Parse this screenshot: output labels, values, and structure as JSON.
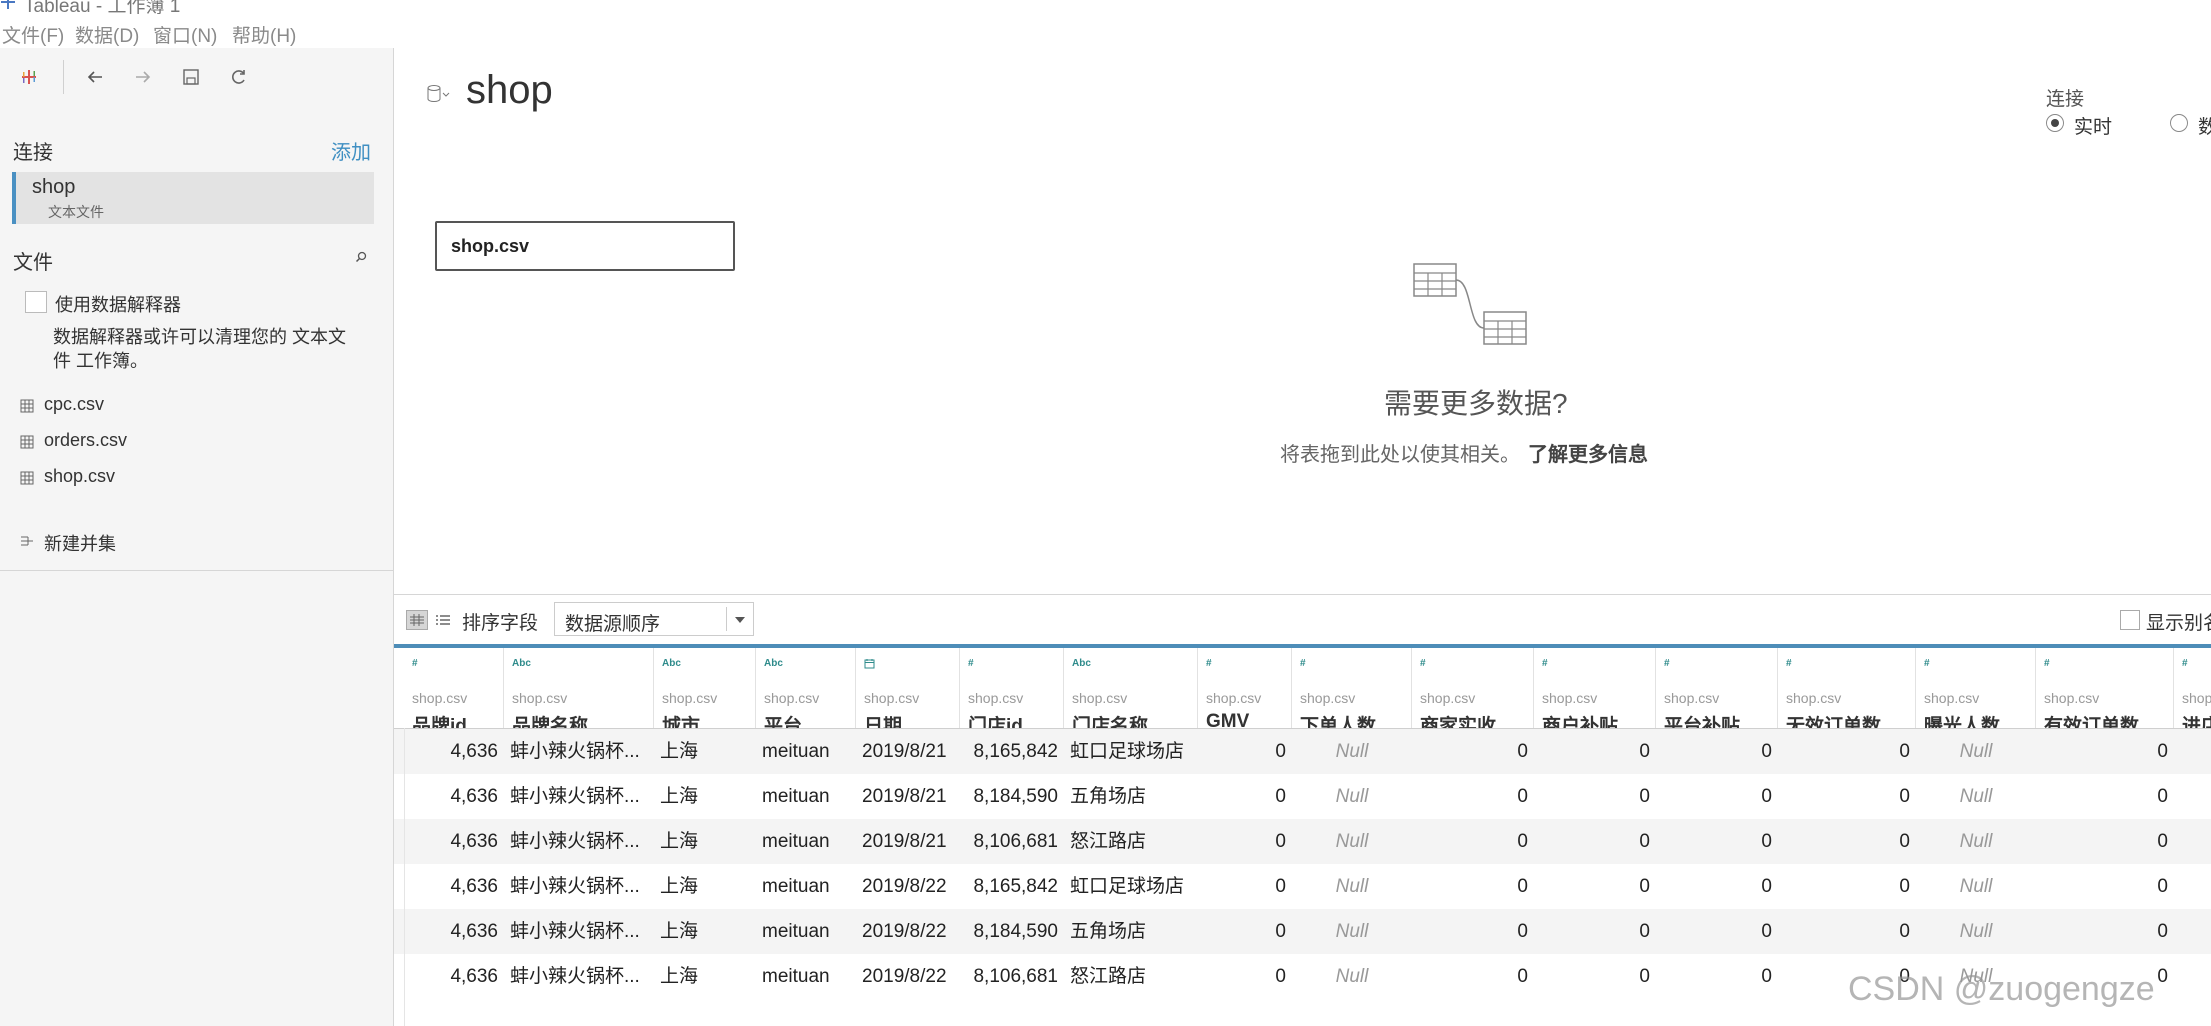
{
  "window": {
    "title": "Tableau - 工作簿 1"
  },
  "menu": [
    "文件(F)",
    "数据(D)",
    "窗口(N)",
    "帮助(H)"
  ],
  "sidebar": {
    "connections_heading": "连接",
    "add_label": "添加",
    "connection": {
      "name": "shop",
      "type": "文本文件"
    },
    "files_heading": "文件",
    "interpreter": {
      "label": "使用数据解释器",
      "description": "数据解释器或许可以清理您的 文本文件 工作簿。",
      "checked": false
    },
    "files": [
      "cpc.csv",
      "orders.csv",
      "shop.csv"
    ],
    "new_union": "新建并集"
  },
  "datasource": {
    "title": "shop"
  },
  "connection_mode": {
    "label": "连接",
    "live_label": "实时",
    "extract_label": "数",
    "selected": "live"
  },
  "canvas": {
    "table": "shop.csv",
    "more_title": "需要更多数据?",
    "more_desc": "将表拖到此处以使其相关。",
    "more_link": "了解更多信息"
  },
  "grid_toolbar": {
    "sort_label": "排序字段",
    "sort_value": "数据源顺序",
    "alias_label": "显示别名",
    "alias_checked": false
  },
  "grid": {
    "columns": [
      {
        "name": "品牌id",
        "source": "shop.csv",
        "type_icon": "#"
      },
      {
        "name": "品牌名称",
        "source": "shop.csv",
        "type_icon": "Abc"
      },
      {
        "name": "城市",
        "source": "shop.csv",
        "type_icon": "Abc"
      },
      {
        "name": "平台",
        "source": "shop.csv",
        "type_icon": "Abc"
      },
      {
        "name": "日期",
        "source": "shop.csv",
        "type_icon": "calendar"
      },
      {
        "name": "门店id",
        "source": "shop.csv",
        "type_icon": "#"
      },
      {
        "name": "门店名称",
        "source": "shop.csv",
        "type_icon": "Abc"
      },
      {
        "name": "GMV",
        "source": "shop.csv",
        "type_icon": "#"
      },
      {
        "name": "下单人数",
        "source": "shop.csv",
        "type_icon": "#"
      },
      {
        "name": "商家实收",
        "source": "shop.csv",
        "type_icon": "#"
      },
      {
        "name": "商户补贴",
        "source": "shop.csv",
        "type_icon": "#"
      },
      {
        "name": "平台补贴",
        "source": "shop.csv",
        "type_icon": "#"
      },
      {
        "name": "无效订单数",
        "source": "shop.csv",
        "type_icon": "#"
      },
      {
        "name": "曝光人数",
        "source": "shop.csv",
        "type_icon": "#"
      },
      {
        "name": "有效订单数",
        "source": "shop.csv",
        "type_icon": "#"
      },
      {
        "name": "进店",
        "source": "shop",
        "type_icon": "#"
      }
    ],
    "rows": [
      [
        "4,636",
        "蚌小辣火锅杯...",
        "上海",
        "meituan",
        "2019/8/21",
        "8,165,842",
        "虹口足球场店",
        "0",
        "Null",
        "0",
        "0",
        "0",
        "0",
        "Null",
        "0",
        ""
      ],
      [
        "4,636",
        "蚌小辣火锅杯...",
        "上海",
        "meituan",
        "2019/8/21",
        "8,184,590",
        "五角场店",
        "0",
        "Null",
        "0",
        "0",
        "0",
        "0",
        "Null",
        "0",
        ""
      ],
      [
        "4,636",
        "蚌小辣火锅杯...",
        "上海",
        "meituan",
        "2019/8/21",
        "8,106,681",
        "怒江路店",
        "0",
        "Null",
        "0",
        "0",
        "0",
        "0",
        "Null",
        "0",
        ""
      ],
      [
        "4,636",
        "蚌小辣火锅杯...",
        "上海",
        "meituan",
        "2019/8/22",
        "8,165,842",
        "虹口足球场店",
        "0",
        "Null",
        "0",
        "0",
        "0",
        "0",
        "Null",
        "0",
        ""
      ],
      [
        "4,636",
        "蚌小辣火锅杯...",
        "上海",
        "meituan",
        "2019/8/22",
        "8,184,590",
        "五角场店",
        "0",
        "Null",
        "0",
        "0",
        "0",
        "0",
        "Null",
        "0",
        ""
      ],
      [
        "4,636",
        "蚌小辣火锅杯...",
        "上海",
        "meituan",
        "2019/8/22",
        "8,106,681",
        "怒江路店",
        "0",
        "Null",
        "0",
        "0",
        "0",
        "0",
        "Null",
        "0",
        ""
      ]
    ]
  },
  "watermark": "CSDN @zuogengze",
  "colors": {
    "accent": "#4d8db8",
    "link": "#3f8fc2",
    "type_icon": "#2e8b8b"
  }
}
